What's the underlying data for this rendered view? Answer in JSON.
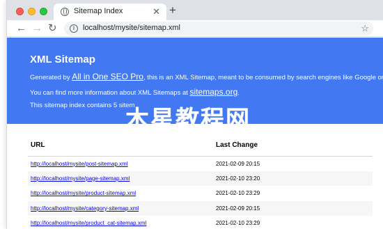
{
  "browser": {
    "tab_title": "Sitemap Index",
    "tab_close": "✕",
    "new_tab": "+",
    "url": "localhost/mysite/sitemap.xml",
    "back_icon": "←",
    "forward_icon": "→",
    "reload_icon": "↻",
    "info_icon": "i",
    "star_icon": "☆"
  },
  "hero": {
    "title": "XML Sitemap",
    "line1_prefix": "Generated by ",
    "line1_link": "All in One SEO Pro",
    "line1_suffix": ", this is an XML Sitemap, meant to be consumed by search engines like Google or Bing.",
    "line2_prefix": "You can find more information about XML Sitemaps at ",
    "line2_link": "sitemaps.org",
    "line2_suffix": ".",
    "line3": "This sitemap index contains 5 sitem",
    "background": "#4278f1"
  },
  "watermark": "木星教程网",
  "table": {
    "headers": [
      "URL",
      "Last Change"
    ],
    "rows": [
      {
        "url": "http://localhost/mysite/post-sitemap.xml",
        "last_change": "2021-02-09 20:15"
      },
      {
        "url": "http://localhost/mysite/page-sitemap.xml",
        "last_change": "2021-02-10 23:20"
      },
      {
        "url": "http://localhost/mysite/product-sitemap.xml",
        "last_change": "2021-02-10 23:29"
      },
      {
        "url": "http://localhost/mysite/category-sitemap.xml",
        "last_change": "2021-02-09 20:15"
      },
      {
        "url": "http://localhost/mysite/product_cat-sitemap.xml",
        "last_change": "2021-02-10 23:29"
      }
    ]
  }
}
